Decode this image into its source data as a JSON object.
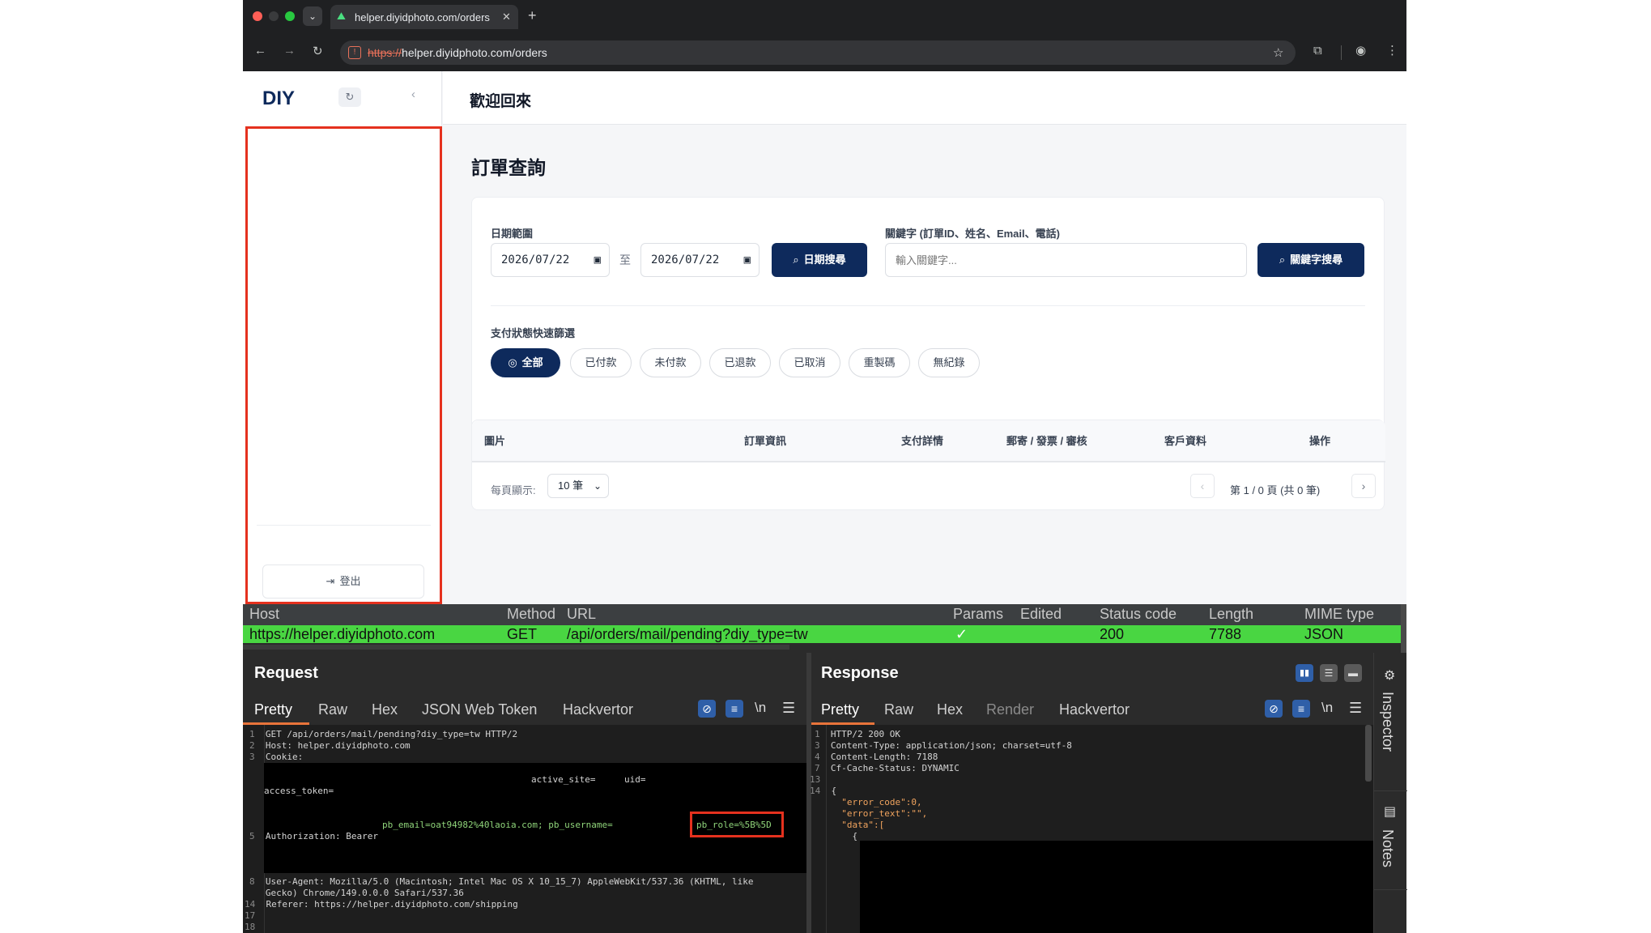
{
  "browser": {
    "tab_title": "helper.diyidphoto.com/orders",
    "url_scheme": "https://",
    "url_rest": "helper.diyidphoto.com/orders"
  },
  "sidebar": {
    "logo": "DIY",
    "logout_label": "登出"
  },
  "header": {
    "welcome": "歡迎回來"
  },
  "page": {
    "title": "訂單查詢"
  },
  "filters": {
    "date_range_label": "日期範圍",
    "date_from": "2026/07/22",
    "date_sep": "至",
    "date_to": "2026/07/22",
    "date_search_label": "日期搜尋",
    "keyword_label": "關鍵字 (訂單ID、姓名、Email、電話)",
    "keyword_placeholder": "輸入關鍵字...",
    "keyword_search_label": "關鍵字搜尋",
    "status_label": "支付狀態快速篩選",
    "status_options": [
      "全部",
      "已付款",
      "未付款",
      "已退款",
      "已取消",
      "重製碼",
      "無紀錄"
    ]
  },
  "table": {
    "columns": [
      "圖片",
      "訂單資訊",
      "支付詳情",
      "郵寄 / 發票 / 審核",
      "客戶資料",
      "操作"
    ],
    "per_page_label": "每頁顯示:",
    "per_page_value": "10 筆",
    "pagination_text": "第 1 / 0 頁 (共 0 筆)"
  },
  "burp": {
    "columns": [
      "Host",
      "Method",
      "URL",
      "Params",
      "Edited",
      "Status code",
      "Length",
      "MIME type"
    ],
    "row": {
      "host": "https://helper.diyidphoto.com",
      "method": "GET",
      "url": "/api/orders/mail/pending?diy_type=tw",
      "params": "✓",
      "status": "200",
      "length": "7788",
      "mime": "JSON"
    },
    "request": {
      "title": "Request",
      "tabs": [
        "Pretty",
        "Raw",
        "Hex",
        "JSON Web Token",
        "Hackvertor"
      ],
      "newline_label": "\\n",
      "lines": [
        {
          "n": "1",
          "t": "GET /api/orders/mail/pending?diy_type=tw HTTP/2"
        },
        {
          "n": "2",
          "t": "Host: helper.diyidphoto.com"
        },
        {
          "n": "3",
          "t": "Cookie:"
        }
      ],
      "cookie_active_site": "active_site=",
      "cookie_uid": "uid=",
      "cookie_access_token": "access_token=",
      "cookie_pb_email": "pb_email=oat94982%40laoia.com; pb_username=",
      "cookie_pb_role": "pb_role=%5B%5D",
      "auth_line_no": "5",
      "auth_line": "Authorization: Bearer",
      "lines_after": [
        {
          "n": "8",
          "t": "User-Agent: Mozilla/5.0 (Macintosh; Intel Mac OS X 10_15_7) AppleWebKit/537.36 (KHTML, like"
        },
        {
          "n": "",
          "t": "Gecko) Chrome/149.0.0.0 Safari/537.36"
        },
        {
          "n": "14",
          "t": "Referer: https://helper.diyidphoto.com/shipping"
        },
        {
          "n": "17",
          "t": ""
        },
        {
          "n": "18",
          "t": ""
        }
      ]
    },
    "response": {
      "title": "Response",
      "tabs": [
        "Pretty",
        "Raw",
        "Hex",
        "Render",
        "Hackvertor"
      ],
      "newline_label": "\\n",
      "lines": [
        {
          "n": "1",
          "t": "HTTP/2 200 OK"
        },
        {
          "n": "3",
          "t": "Content-Type: application/json; charset=utf-8"
        },
        {
          "n": "4",
          "t": "Content-Length: 7188"
        },
        {
          "n": "7",
          "t": "Cf-Cache-Status: DYNAMIC"
        },
        {
          "n": "13",
          "t": ""
        },
        {
          "n": "14",
          "t": "{"
        },
        {
          "n": "",
          "t": "  \"error_code\":0,"
        },
        {
          "n": "",
          "t": "  \"error_text\":\"\","
        },
        {
          "n": "",
          "t": "  \"data\":["
        },
        {
          "n": "",
          "t": "    {"
        }
      ]
    },
    "side_tabs": {
      "inspector": "Inspector",
      "notes": "Notes"
    }
  },
  "colors": {
    "primary": "#0e2a5c",
    "burp_green": "#49d642",
    "highlight_red": "#e5311e"
  }
}
